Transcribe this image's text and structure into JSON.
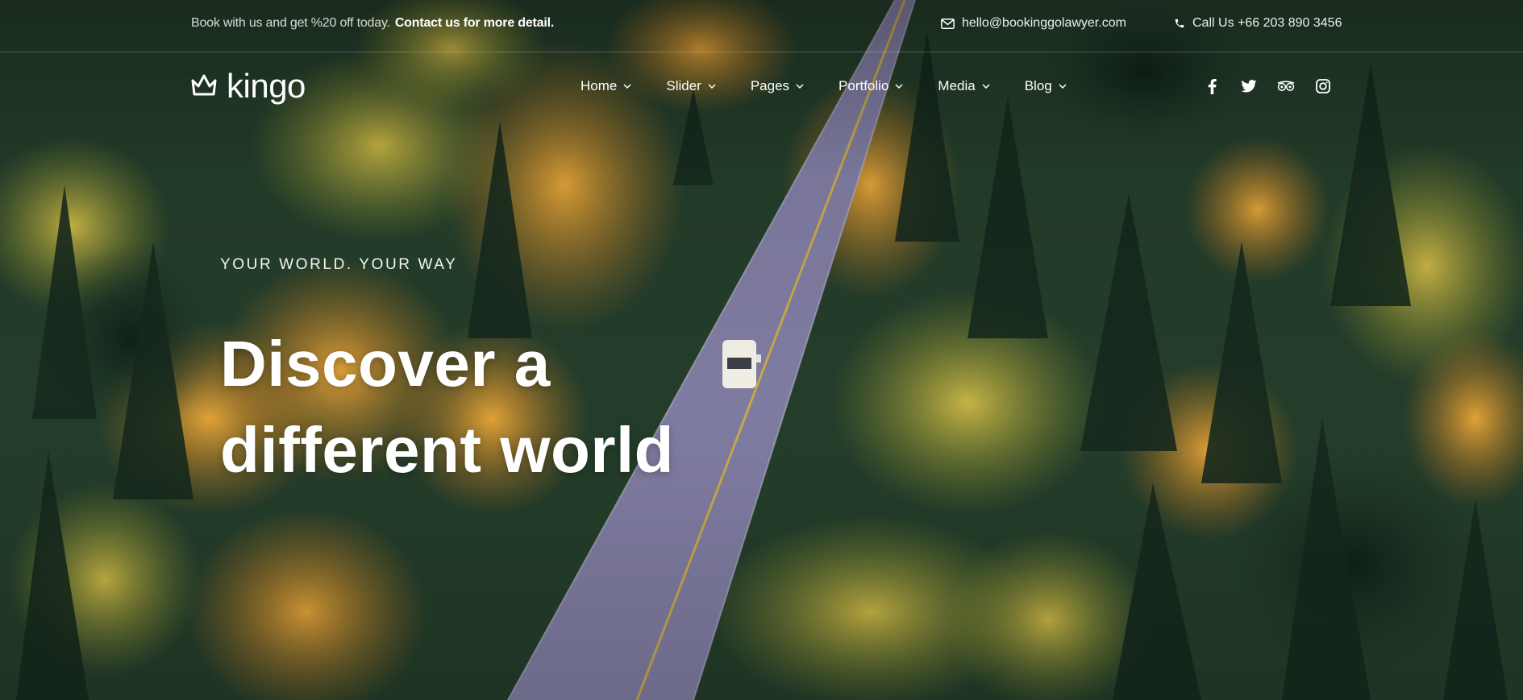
{
  "topbar": {
    "promo_text": "Book with us and get %20 off today.",
    "promo_link": "Contact us for more detail.",
    "email": "hello@bookinggolawyer.com",
    "phone": "Call Us +66 203 890 3456",
    "email_icon": "envelope-icon",
    "phone_icon": "phone-icon"
  },
  "brand": {
    "name": "kingo",
    "logo_icon": "crown-icon"
  },
  "nav": {
    "items": [
      {
        "label": "Home"
      },
      {
        "label": "Slider"
      },
      {
        "label": "Pages"
      },
      {
        "label": "Portfolio"
      },
      {
        "label": "Media"
      },
      {
        "label": "Blog"
      }
    ]
  },
  "social": [
    "facebook-icon",
    "twitter-icon",
    "tripadvisor-icon",
    "instagram-icon"
  ],
  "hero": {
    "eyebrow": "YOUR WORLD. YOUR WAY",
    "title_line1": "Discover a",
    "title_line2": "different world"
  },
  "colors": {
    "forest_dark": "#1f3526",
    "foliage_orange": "#d9962f",
    "foliage_yellow": "#c9a83a",
    "road": "#7d7aa0",
    "text": "#ffffff"
  }
}
